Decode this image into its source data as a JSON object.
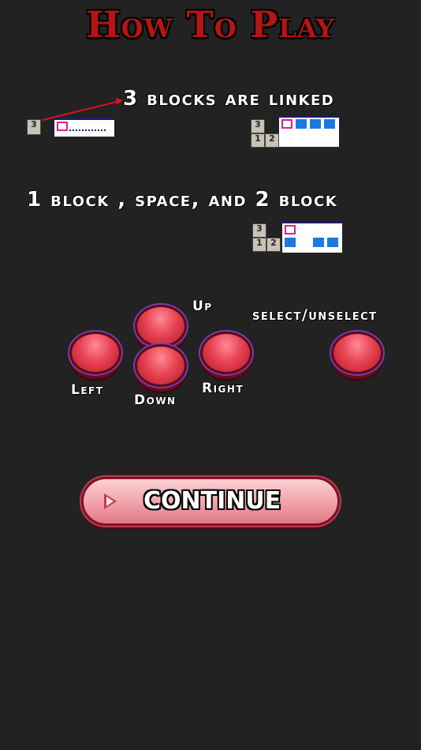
{
  "title": "How To Play",
  "examples": {
    "linked": "3 blocks are linked",
    "spaced": "1 block , space, and 2 block"
  },
  "tiles": {
    "three": "3",
    "one": "1",
    "two": "2"
  },
  "controls": {
    "up": "Up",
    "down": "Down",
    "left": "Left",
    "right": "Right",
    "select": "select/unselect"
  },
  "continue_label": "CONTINUE",
  "colors": {
    "background": "#222222",
    "title": "#b51515",
    "button_red": "#e84454",
    "cell_blue": "#1a7ae0",
    "cell_select": "#e0208a"
  }
}
